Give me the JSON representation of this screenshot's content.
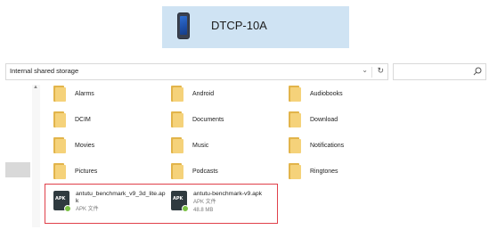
{
  "device": {
    "name": "DTCP-10A",
    "icon": "phone-icon"
  },
  "path": {
    "location": "Internal shared storage",
    "dropdown_icon": "chevron-down-icon",
    "refresh_icon": "refresh-icon"
  },
  "search": {
    "placeholder": "",
    "icon": "search-icon"
  },
  "folders": [
    "Alarms",
    "Android",
    "Audiobooks",
    "DCIM",
    "Documents",
    "Download",
    "Movies",
    "Music",
    "Notifications",
    "Pictures",
    "Podcasts",
    "Ringtones"
  ],
  "files": [
    {
      "name_line1": "antutu_benchmark_v9_3d_lite.ap",
      "name_line2": "k",
      "type": "APK 文件",
      "size": "",
      "icon": "apk-icon"
    },
    {
      "name_line1": "antutu-benchmark-v9.apk",
      "name_line2": "",
      "type": "APK 文件",
      "size": "48.8 MB",
      "icon": "apk-icon"
    }
  ],
  "colors": {
    "header_bg": "#cfe3f3",
    "highlight_border": "#e0404a",
    "folder": "#f5d27a"
  }
}
